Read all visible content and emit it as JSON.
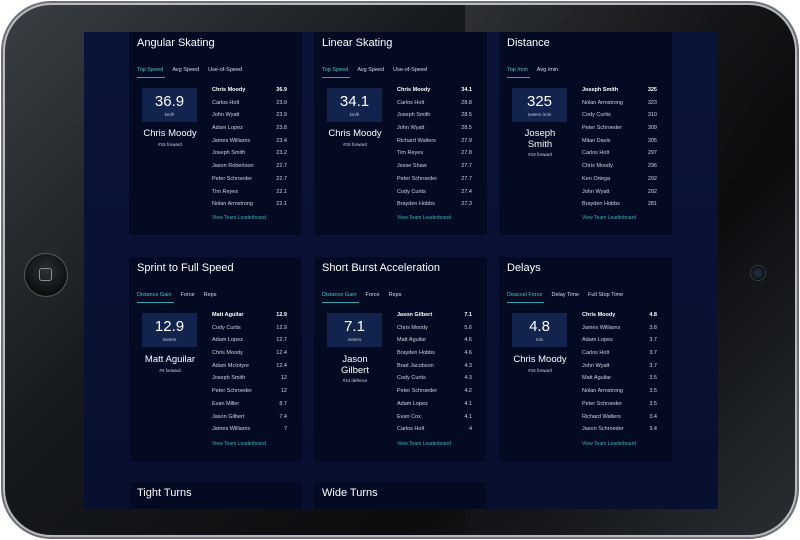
{
  "cards": [
    {
      "title": "Angular Skating",
      "tabs": [
        "Top Speed",
        "Avg Speed",
        "Use-of-Speed"
      ],
      "stat": {
        "value": "36.9",
        "unit": "km/h"
      },
      "player": {
        "name": "Chris Moody",
        "meta": "#15 forward"
      },
      "rows": [
        {
          "name": "Chris Moody",
          "value": "36.9"
        },
        {
          "name": "Carlos Holt",
          "value": "23.9"
        },
        {
          "name": "John Wyatt",
          "value": "23.9"
        },
        {
          "name": "Adam Lopez",
          "value": "23.8"
        },
        {
          "name": "James Williams",
          "value": "23.4"
        },
        {
          "name": "Joseph Smith",
          "value": "23.2"
        },
        {
          "name": "Jason Robertson",
          "value": "22.7"
        },
        {
          "name": "Peter Schroeder",
          "value": "22.7"
        },
        {
          "name": "Tim Reyes",
          "value": "22.1"
        },
        {
          "name": "Nolan Armstrong",
          "value": "22.1"
        }
      ],
      "link": "View Team Leaderboard"
    },
    {
      "title": "Linear Skating",
      "tabs": [
        "Top Speed",
        "Avg Speed",
        "Use-of-Speed"
      ],
      "stat": {
        "value": "34.1",
        "unit": "km/h"
      },
      "player": {
        "name": "Chris Moody",
        "meta": "#15 forward"
      },
      "rows": [
        {
          "name": "Chris Moody",
          "value": "34.1"
        },
        {
          "name": "Carlos Holt",
          "value": "28.8"
        },
        {
          "name": "Joseph Smith",
          "value": "28.5"
        },
        {
          "name": "John Wyatt",
          "value": "28.5"
        },
        {
          "name": "Richard Walters",
          "value": "27.9"
        },
        {
          "name": "Tim Reyes",
          "value": "27.8"
        },
        {
          "name": "Jesse Shaw",
          "value": "27.7"
        },
        {
          "name": "Peter Schroeder",
          "value": "27.7"
        },
        {
          "name": "Cody Curtis",
          "value": "27.4"
        },
        {
          "name": "Brayden Hobbs",
          "value": "27.3"
        }
      ],
      "link": "View Team Leaderboard"
    },
    {
      "title": "Distance",
      "tabs": [
        "Top /min",
        "Avg /min"
      ],
      "stat": {
        "value": "325",
        "unit": "meters /min"
      },
      "player": {
        "name": "Joseph Smith",
        "meta": "#19 forward"
      },
      "rows": [
        {
          "name": "Joseph Smith",
          "value": "325"
        },
        {
          "name": "Nolan Armstrong",
          "value": "323"
        },
        {
          "name": "Cody Curtis",
          "value": "310"
        },
        {
          "name": "Peter Schroeder",
          "value": "309"
        },
        {
          "name": "Milan Davis",
          "value": "305"
        },
        {
          "name": "Carlos Holt",
          "value": "297"
        },
        {
          "name": "Chris Moody",
          "value": "296"
        },
        {
          "name": "Ken Ortega",
          "value": "292"
        },
        {
          "name": "John Wyatt",
          "value": "292"
        },
        {
          "name": "Brayden Hobbs",
          "value": "281"
        }
      ],
      "link": "View Team Leaderboard"
    },
    {
      "title": "Sprint to Full Speed",
      "tabs": [
        "Distance Gain",
        "Force",
        "Reps"
      ],
      "stat": {
        "value": "12.9",
        "unit": "meters"
      },
      "player": {
        "name": "Matt Aguilar",
        "meta": "#4 forward"
      },
      "rows": [
        {
          "name": "Matt Aguilar",
          "value": "12.9"
        },
        {
          "name": "Cody Curtis",
          "value": "12.9"
        },
        {
          "name": "Adam Lopez",
          "value": "12.7"
        },
        {
          "name": "Chris Moody",
          "value": "12.4"
        },
        {
          "name": "Adam McIntyre",
          "value": "12.4"
        },
        {
          "name": "Joseph Smith",
          "value": "12"
        },
        {
          "name": "Peter Schroeder",
          "value": "12"
        },
        {
          "name": "Evan Miller",
          "value": "8.7"
        },
        {
          "name": "Jason Gilbert",
          "value": "7.4"
        },
        {
          "name": "James Williams",
          "value": "7"
        }
      ],
      "link": "View Team Leaderboard"
    },
    {
      "title": "Short Burst Acceleration",
      "tabs": [
        "Distance Gain",
        "Force",
        "Reps"
      ],
      "stat": {
        "value": "7.1",
        "unit": "meters"
      },
      "player": {
        "name": "Jason Gilbert",
        "meta": "#14 defence"
      },
      "rows": [
        {
          "name": "Jason Gilbert",
          "value": "7.1"
        },
        {
          "name": "Chris Moody",
          "value": "5.6"
        },
        {
          "name": "Matt Aguilar",
          "value": "4.6"
        },
        {
          "name": "Brayden Hobbs",
          "value": "4.6"
        },
        {
          "name": "Brad Jacobson",
          "value": "4.3"
        },
        {
          "name": "Cody Curtis",
          "value": "4.3"
        },
        {
          "name": "Peter Schroeder",
          "value": "4.2"
        },
        {
          "name": "Adam Lopez",
          "value": "4.1"
        },
        {
          "name": "Evan Cox",
          "value": "4.1"
        },
        {
          "name": "Carlos Holt",
          "value": "4"
        }
      ],
      "link": "View Team Leaderboard"
    },
    {
      "title": "Delays",
      "tabs": [
        "Deaccel Force",
        "Delay Time",
        "Full Stop Time"
      ],
      "stat": {
        "value": "4.8",
        "unit": "m/s"
      },
      "player": {
        "name": "Chris Moody",
        "meta": "#15 forward"
      },
      "rows": [
        {
          "name": "Chris Moody",
          "value": "4.8"
        },
        {
          "name": "James Williams",
          "value": "3.8"
        },
        {
          "name": "Adam Lopez",
          "value": "3.7"
        },
        {
          "name": "Carlos Holt",
          "value": "3.7"
        },
        {
          "name": "John Wyatt",
          "value": "3.7"
        },
        {
          "name": "Matt Aguilar",
          "value": "3.5"
        },
        {
          "name": "Nolan Armstrong",
          "value": "3.5"
        },
        {
          "name": "Peter Schroeder",
          "value": "3.5"
        },
        {
          "name": "Richard Walters",
          "value": "3.4"
        },
        {
          "name": "Jason Schroeder",
          "value": "3.4"
        }
      ],
      "link": "View Team Leaderboard"
    },
    {
      "title": "Tight Turns"
    },
    {
      "title": "Wide Turns"
    }
  ]
}
